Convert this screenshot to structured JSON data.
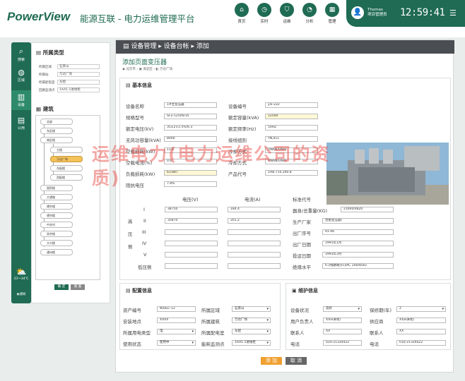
{
  "header": {
    "logo_brand": "PowerView",
    "title": "能源互联 - 电力运维管理平台",
    "nav": [
      "首页",
      "实时",
      "运维",
      "分析",
      "管理"
    ],
    "user_name": "Thomas",
    "user_role": "项目管理员",
    "clock": "12:59:41"
  },
  "left_nav": [
    "搜索",
    "区域",
    "设备",
    "公用"
  ],
  "left_panel": {
    "section1_title": "所属类型",
    "filters": [
      {
        "label": "所属区域",
        "value": "石景山"
      },
      {
        "label": "所属站",
        "value": "万达广场"
      },
      {
        "label": "所属配电室",
        "value": "东配"
      },
      {
        "label": "回路监测点",
        "value": "1AA1.1进线柜"
      }
    ],
    "section2_title": "建筑",
    "tree": [
      "总部",
      "东区楼",
      "南区楼",
      "主楼",
      "万达广场",
      "东配楼",
      "西配楼",
      "国贸楼",
      "大望路",
      "建外楼",
      "望京楼",
      "中关村",
      "双井楼",
      "大兴楼",
      "通州楼"
    ],
    "btn_ok": "确 定",
    "btn_reset": "重 置",
    "weather": "33～34℃",
    "footer_icon_label": "通知"
  },
  "breadcrumb": [
    "设备管理",
    "设备台帐",
    "添加"
  ],
  "page_subtitle": "添加页面变压器",
  "location": [
    "北京市",
    "海淀区",
    "万达广场"
  ],
  "basic": {
    "title": "基本信息",
    "fields_left": [
      {
        "label": "设备名称",
        "value": "1#主变压器"
      },
      {
        "label": "规格型号",
        "value": "SFZ-12500/35"
      },
      {
        "label": "额定电压(kV)",
        "value": "35±2×2.5%/6.3"
      },
      {
        "label": "无风功容量(kVA)",
        "value": "8000"
      },
      {
        "label": "空载损耗(kW)",
        "value": "11.6"
      },
      {
        "label": "空载电流(%)",
        "value": "0.6"
      },
      {
        "label": "负载损耗(kW)",
        "value": "63.887"
      },
      {
        "label": "阻抗电压",
        "value": "7.8%"
      }
    ],
    "fields_right": [
      {
        "label": "设备编号",
        "value": "ylx-222"
      },
      {
        "label": "额定容量(kVA)",
        "value": "12500"
      },
      {
        "label": "额定频率(Hz)",
        "value": "50HZ"
      },
      {
        "label": "接线组别",
        "value": "YN,d11"
      },
      {
        "label": "冷却方式",
        "value": "ONAN/ONAF"
      },
      {
        "label": "冷却方式",
        "value": "ONAN/ONAF"
      },
      {
        "label": "产品代号",
        "value": "1HB.710.260.8"
      }
    ],
    "voltage_headers": [
      "电压(V)",
      "电流(A)"
    ],
    "taps": [
      "I",
      "II",
      "III",
      "IV",
      "V",
      "低压侧"
    ],
    "side_chars": [
      "高",
      "压",
      "侧"
    ],
    "voltages": [
      "38750",
      "35870",
      "",
      "",
      "",
      ""
    ],
    "currents": [
      "184.4",
      "201.2",
      "",
      "",
      "",
      ""
    ],
    "fields_far": [
      {
        "label": "标准代号",
        "value": "GB1094.1-5-85"
      },
      {
        "label": "器身/总重量(KG)",
        "value": "21600/4820"
      },
      {
        "label": "生产厂家",
        "value": "合肥变压器厂"
      },
      {
        "label": "出厂序号",
        "value": "91-06"
      },
      {
        "label": "出厂日期",
        "value": "1991年1月"
      },
      {
        "label": "投运日期",
        "value": "1993年3月"
      },
      {
        "label": "绝缘水平",
        "value": "h.v线路端子LI/AC 200/85kv"
      }
    ]
  },
  "config": {
    "title": "配置信息",
    "rows": [
      [
        {
          "label": "资产编号",
          "value": "WDGC-12"
        },
        {
          "label": "所属区域",
          "value": "石景山"
        }
      ],
      [
        {
          "label": "安装地点",
          "value": "XXXX"
        },
        {
          "label": "所属建筑",
          "value": "万达广场"
        }
      ],
      [
        {
          "label": "所属用电类型",
          "value": "电"
        },
        {
          "label": "所属配电室",
          "value": "东配"
        }
      ],
      [
        {
          "label": "使用状态",
          "value": "使用中"
        },
        {
          "label": "能耗监测点",
          "value": "1AA1.1进线柜"
        }
      ]
    ]
  },
  "maint": {
    "title": "维护信息",
    "rows": [
      [
        {
          "label": "设备状况",
          "value": "良好"
        },
        {
          "label": "保修期(年)",
          "value": "2"
        }
      ],
      [
        {
          "label": "用户负责人",
          "value": "XX开关柜厂"
        },
        {
          "label": "供应商",
          "value": "XX开关柜厂"
        }
      ],
      [
        {
          "label": "联系人",
          "value": "XX"
        },
        {
          "label": "联系人",
          "value": "XX"
        }
      ],
      [
        {
          "label": "电话",
          "value": "010-21334422"
        },
        {
          "label": "电话",
          "value": "010-21334422"
        }
      ]
    ]
  },
  "actions": {
    "add": "添 加",
    "cancel": "取 消"
  },
  "watermark": "运维电力(电力运维公司的资质)",
  "colors": {
    "brand": "#1f6b53",
    "accent": "#f0a030",
    "breadcrumb_bg": "#4a4e52"
  }
}
